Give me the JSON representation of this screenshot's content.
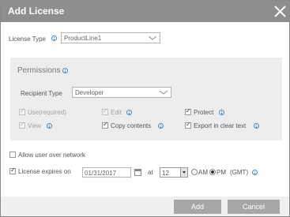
{
  "dialog": {
    "title": "Add License"
  },
  "license_type": {
    "label": "License Type",
    "value": "ProductLine1"
  },
  "permissions": {
    "title": "Permissions",
    "recipient_type": {
      "label": "Recipient Type",
      "value": "Developer"
    },
    "options": {
      "use": {
        "label": "Use(required)",
        "checked": true,
        "enabled": false
      },
      "edit": {
        "label": "Edit",
        "checked": true,
        "enabled": false
      },
      "protect": {
        "label": "Protect",
        "checked": true,
        "enabled": true
      },
      "view": {
        "label": "View",
        "checked": true,
        "enabled": false
      },
      "copy": {
        "label": "Copy contents",
        "checked": true,
        "enabled": true
      },
      "export": {
        "label": "Export in clear text",
        "checked": true,
        "enabled": true
      }
    }
  },
  "allow_network": {
    "label": "Allow user over network",
    "checked": false
  },
  "expiry": {
    "label": "License expires on",
    "checked": true,
    "date": "01/31/2017",
    "at_label": "at",
    "hour": "12",
    "am_label": "AM",
    "pm_label": "PM",
    "selected_period": "PM",
    "timezone": "(GMT)"
  },
  "buttons": {
    "add": "Add",
    "cancel": "Cancel"
  },
  "colors": {
    "titlebar": "#8e8e8e",
    "button": "#a6a6a6",
    "panel": "#ededed",
    "info": "#3a8fd6"
  }
}
